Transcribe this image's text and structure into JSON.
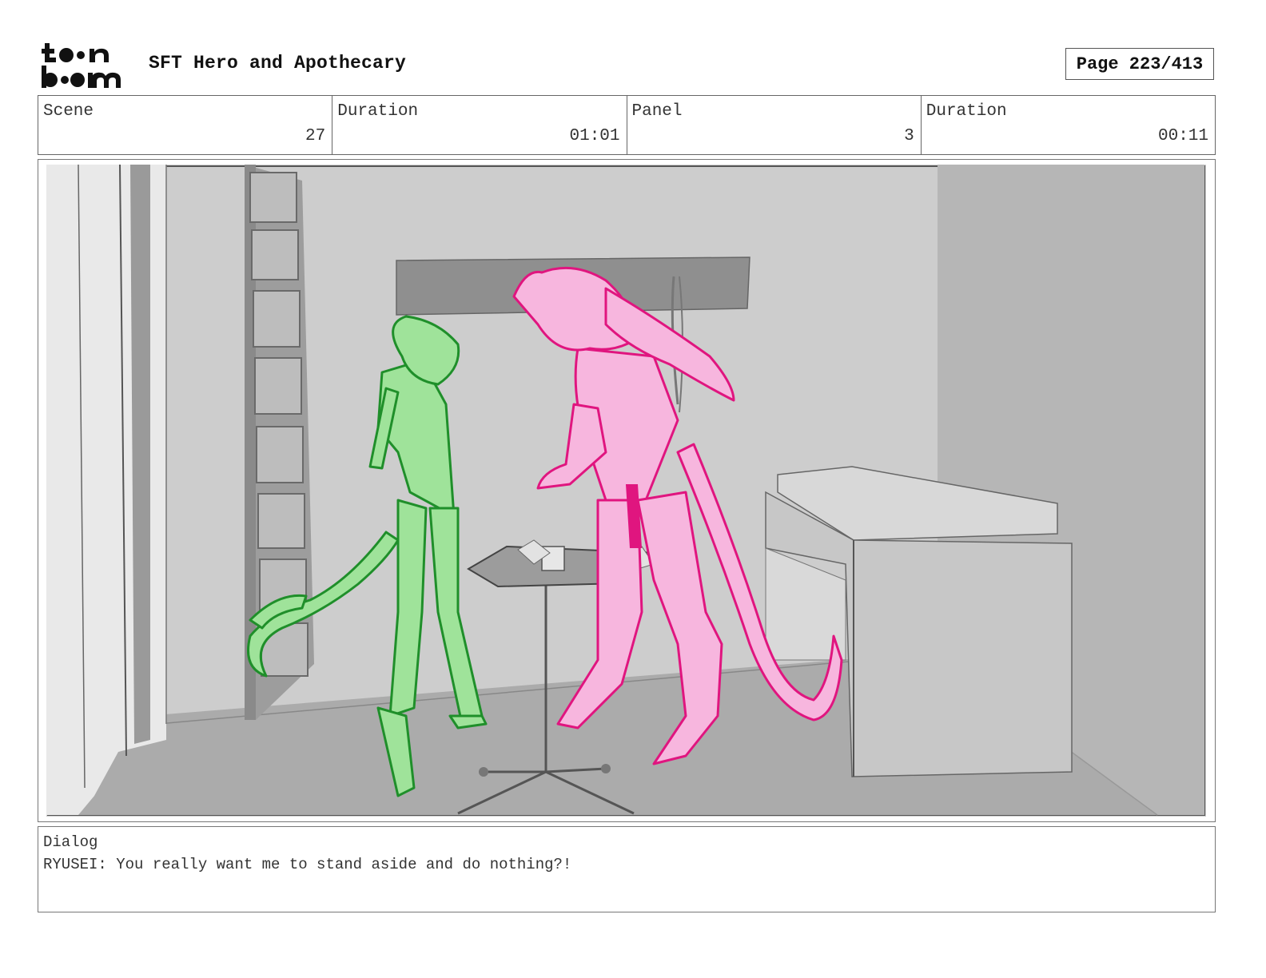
{
  "header": {
    "logo_text": "toon boom",
    "title": "SFT Hero and Apothecary",
    "page": "Page 223/413"
  },
  "info": {
    "scene_label": "Scene",
    "scene_value": "27",
    "scene_duration_label": "Duration",
    "scene_duration_value": "01:01",
    "panel_label": "Panel",
    "panel_value": "3",
    "panel_duration_label": "Duration",
    "panel_duration_value": "00:11"
  },
  "dialog": {
    "label": "Dialog",
    "text": "RYUSEI: You really want me to stand aside and do nothing?!"
  },
  "colors": {
    "green_character": "#9fe39a",
    "green_line": "#1f8f2a",
    "pink_character": "#f7b6de",
    "pink_line": "#e0157f",
    "room_gray": "#cbcbcb"
  }
}
